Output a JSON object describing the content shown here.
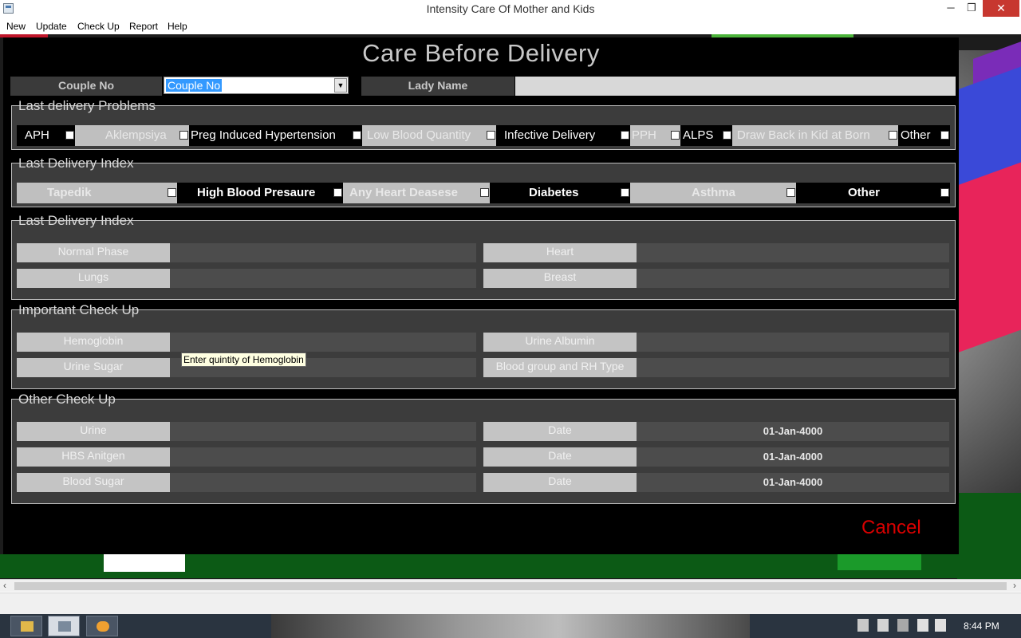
{
  "window": {
    "title": "Intensity Care Of Mother and Kids",
    "min": "─",
    "max": "❐",
    "close": "✕"
  },
  "menu": [
    "New",
    "Update",
    "Check Up",
    "Report",
    "Help"
  ],
  "form": {
    "title": "Care Before Delivery",
    "couple_label": "Couple No",
    "couple_value": "Couple No",
    "lady_label": "Lady Name",
    "lady_value": ""
  },
  "problems": {
    "title": "Last delivery Problems",
    "items": [
      "APH",
      "Aklempsiya",
      "Preg Induced Hypertension",
      "Low  Blood Quantity",
      "Infective Delivery",
      "PPH",
      "ALPS",
      "Draw Back in Kid at Born",
      "Other"
    ]
  },
  "index1": {
    "title": "Last Delivery Index",
    "items": [
      "Tapedik",
      "High Blood Presaure",
      "Any Heart Deasese",
      "Diabetes",
      "Asthma",
      "Other"
    ]
  },
  "index2": {
    "title": "Last Delivery Index",
    "fields": [
      "Normal Phase",
      "Heart",
      "Lungs",
      "Breast"
    ]
  },
  "important": {
    "title": "Important Check Up",
    "fields": [
      "Hemoglobin",
      "Urine Albumin",
      "Urine Sugar",
      "Blood group and RH Type"
    ]
  },
  "other": {
    "title": "Other Check Up",
    "rows": [
      {
        "label": "Urine",
        "date_label": "Date",
        "date": "01-Jan-4000"
      },
      {
        "label": "HBS Anitgen",
        "date_label": "Date",
        "date": "01-Jan-4000"
      },
      {
        "label": "Blood Sugar",
        "date_label": "Date",
        "date": "01-Jan-4000"
      }
    ]
  },
  "tooltip": "Enter quintity of Hemoglobin",
  "cancel": "Cancel",
  "taskbar": {
    "clock": "8:44 PM"
  }
}
